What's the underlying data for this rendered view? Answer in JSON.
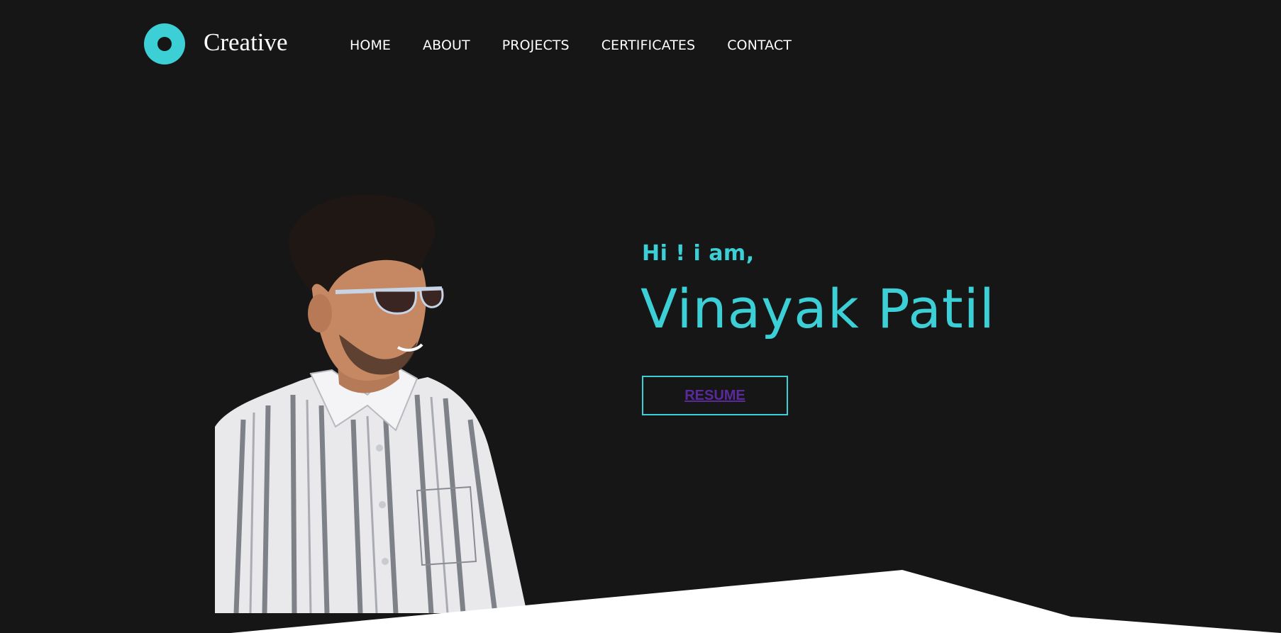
{
  "header": {
    "brand": "Creative",
    "nav": [
      "HOME",
      "ABOUT",
      "PROJECTS",
      "CERTIFICATES",
      "CONTACT"
    ]
  },
  "hero": {
    "greeting": "Hi ! i am,",
    "name": "Vinayak Patil",
    "resume_label": "RESUME"
  },
  "colors": {
    "background": "#161616",
    "accent": "#3ccfd6",
    "link": "#5b2a9a",
    "text": "#ffffff"
  },
  "icons": {
    "logo": "ring-logo-icon"
  }
}
